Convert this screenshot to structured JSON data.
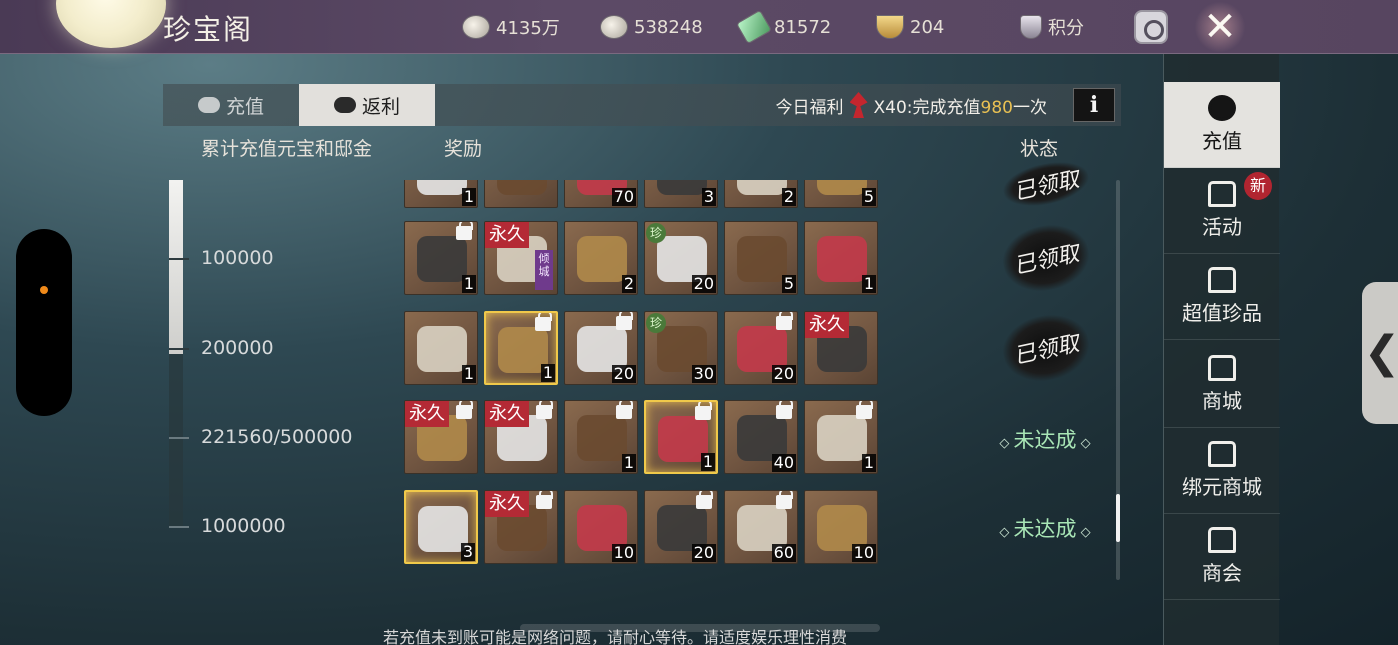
{
  "header": {
    "title": "珍宝阁",
    "resources": [
      {
        "icon": "silver-coins-icon",
        "value": "4135万"
      },
      {
        "icon": "ingot-icon",
        "value": "538248"
      },
      {
        "icon": "jade-icon",
        "value": "81572"
      },
      {
        "icon": "gold-bowl-icon",
        "value": "204"
      }
    ],
    "points_label": "积分"
  },
  "tabs": {
    "recharge": "充值",
    "rebate": "返利"
  },
  "welfare": {
    "prefix": "今日福利",
    "text_before": "X40:完成充值",
    "highlight": "980",
    "text_after": "一次",
    "info": "i"
  },
  "columns": {
    "threshold": "累计充值元宝和邸金",
    "reward": "奖励",
    "status": "状态"
  },
  "progress": {
    "current": 221560,
    "target": 500000
  },
  "tiers": [
    {
      "label": "100000",
      "status": "已领取"
    },
    {
      "label": "200000",
      "status": "已领取"
    },
    {
      "label": "221560/500000",
      "status": "未达成"
    },
    {
      "label": "1000000",
      "status": "未达成"
    }
  ],
  "partial_row": {
    "status": "已领取",
    "counts": [
      "1",
      "",
      "70",
      "3",
      "2",
      "5"
    ]
  },
  "rows": [
    {
      "items": [
        {
          "count": "1",
          "lock": true
        },
        {
          "count": "",
          "perm": "永久",
          "tag": "倾城"
        },
        {
          "count": "2"
        },
        {
          "count": "20",
          "rare": "珍"
        },
        {
          "count": "5"
        },
        {
          "count": "1"
        }
      ]
    },
    {
      "items": [
        {
          "count": "1"
        },
        {
          "count": "1",
          "lock": true,
          "gold": true
        },
        {
          "count": "20",
          "lock": true
        },
        {
          "count": "30",
          "rare": "珍"
        },
        {
          "count": "20",
          "lock": true
        },
        {
          "count": "",
          "perm": "永久"
        }
      ]
    },
    {
      "items": [
        {
          "count": "",
          "perm": "永久",
          "lock": true
        },
        {
          "count": "",
          "perm": "永久",
          "lock": true
        },
        {
          "count": "1",
          "lock": true
        },
        {
          "count": "1",
          "lock": true,
          "gold": true
        },
        {
          "count": "40",
          "lock": true
        },
        {
          "count": "1",
          "lock": true
        }
      ]
    },
    {
      "items": [
        {
          "count": "3",
          "gold": true
        },
        {
          "count": "",
          "perm": "永久",
          "lock": true
        },
        {
          "count": "10"
        },
        {
          "count": "20",
          "lock": true
        },
        {
          "count": "60",
          "lock": true
        },
        {
          "count": "10"
        }
      ]
    }
  ],
  "footer": "若充值未到账可能是网络问题，请耐心等待。请适度娱乐理性消费",
  "nav": {
    "items": [
      {
        "label": "充值",
        "icon": "money-bag-icon"
      },
      {
        "label": "活动",
        "icon": "pavilion-icon"
      },
      {
        "label": "超值珍品",
        "icon": "pavilion-icon"
      },
      {
        "label": "商城",
        "icon": "shop-icon"
      },
      {
        "label": "绑元商城",
        "icon": "shop-icon"
      },
      {
        "label": "商会",
        "icon": "guild-icon"
      }
    ],
    "new_badge": "新",
    "collapse": "❮"
  },
  "colors": {
    "accent_gold": "#e8c053",
    "pending_green": "#a9e6b6",
    "permanent_red": "#b42a35"
  }
}
